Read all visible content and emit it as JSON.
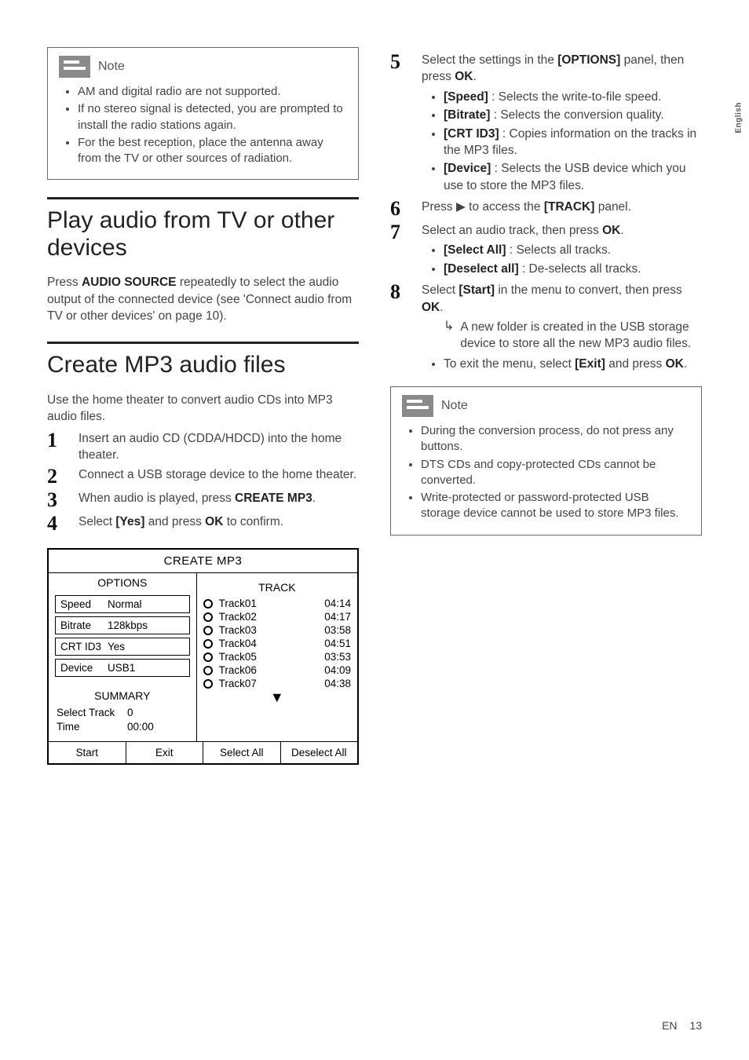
{
  "lang_side": "English",
  "footer": {
    "lang": "EN",
    "page": "13"
  },
  "left": {
    "note1": {
      "title": "Note",
      "items": [
        "AM and digital radio are not supported.",
        "If no stereo signal is detected, you are prompted to install the radio stations again.",
        "For the best reception, place the antenna away from the TV or other sources of radiation."
      ]
    },
    "h_play": "Play audio from TV or other devices",
    "play_para_a": "Press ",
    "play_para_bold": "AUDIO SOURCE",
    "play_para_b": " repeatedly to select the audio output of the connected device (see 'Connect audio from TV or other devices' on page 10).",
    "h_mp3": "Create MP3 audio files",
    "mp3_intro": "Use the home theater to convert audio CDs into MP3 audio files.",
    "steps": {
      "s1": "Insert an audio CD (CDDA/HDCD) into the home theater.",
      "s2": "Connect a USB storage device to the home theater.",
      "s3_a": "When audio is played, press ",
      "s3_b": "CREATE MP3",
      "s3_c": ".",
      "s4_a": "Select ",
      "s4_b": "[Yes]",
      "s4_c": " and press ",
      "s4_d": "OK",
      "s4_e": " to confirm."
    },
    "screen": {
      "title": "CREATE MP3",
      "options_label": "OPTIONS",
      "track_label": "TRACK",
      "opts": [
        {
          "k": "Speed",
          "v": "Normal"
        },
        {
          "k": "Bitrate",
          "v": "128kbps"
        },
        {
          "k": "CRT ID3",
          "v": "Yes"
        },
        {
          "k": "Device",
          "v": "USB1"
        }
      ],
      "summary_label": "SUMMARY",
      "summary": [
        {
          "k": "Select Track",
          "v": "0"
        },
        {
          "k": "Time",
          "v": "00:00"
        }
      ],
      "tracks": [
        {
          "name": "Track01",
          "time": "04:14"
        },
        {
          "name": "Track02",
          "time": "04:17"
        },
        {
          "name": "Track03",
          "time": "03:58"
        },
        {
          "name": "Track04",
          "time": "04:51"
        },
        {
          "name": "Track05",
          "time": "03:53"
        },
        {
          "name": "Track06",
          "time": "04:09"
        },
        {
          "name": "Track07",
          "time": "04:38"
        }
      ],
      "btn_start": "Start",
      "btn_exit": "Exit",
      "btn_selall": "Select All",
      "btn_deselall": "Deselect All"
    }
  },
  "right": {
    "s5_a": "Select the settings in the ",
    "s5_b": "[OPTIONS]",
    "s5_c": " panel, then press ",
    "s5_d": "OK",
    "s5_e": ".",
    "s5_items": [
      {
        "b": "[Speed]",
        "t": " : Selects the write-to-file speed."
      },
      {
        "b": "[Bitrate]",
        "t": " : Selects the conversion quality."
      },
      {
        "b": "[CRT ID3]",
        "t": " : Copies information on the tracks in the MP3 files."
      },
      {
        "b": "[Device]",
        "t": " : Selects the USB device which you use to store the MP3 files."
      }
    ],
    "s6_a": "Press ",
    "s6_b": " to access the ",
    "s6_c": "[TRACK]",
    "s6_d": " panel.",
    "s7_a": "Select an audio track, then press ",
    "s7_b": "OK",
    "s7_c": ".",
    "s7_items": [
      {
        "b": "[Select All]",
        "t": " : Selects all tracks."
      },
      {
        "b": "[Deselect all]",
        "t": " : De-selects all tracks."
      }
    ],
    "s8_a": "Select ",
    "s8_b": "[Start]",
    "s8_c": " in the menu to convert, then press ",
    "s8_d": "OK",
    "s8_e": ".",
    "s8_result": "A new folder is created in the USB storage device to store all the new MP3 audio files.",
    "s8_exit_a": "To exit the menu, select ",
    "s8_exit_b": "[Exit]",
    "s8_exit_c": " and press ",
    "s8_exit_d": "OK",
    "s8_exit_e": ".",
    "note2": {
      "title": "Note",
      "items": [
        "During the conversion process, do not press any buttons.",
        "DTS CDs and copy-protected CDs cannot be converted.",
        "Write-protected or password-protected USB storage device cannot be used to store MP3 files."
      ]
    }
  }
}
